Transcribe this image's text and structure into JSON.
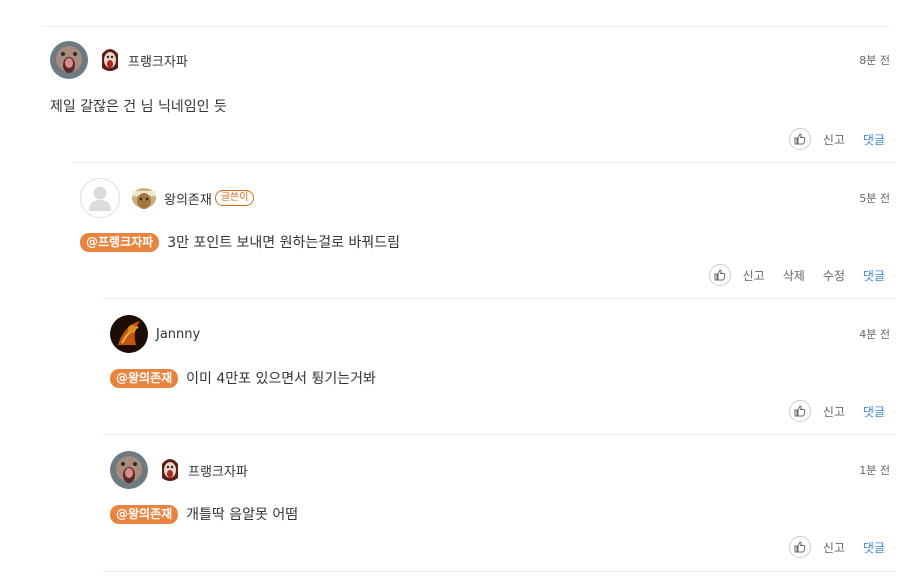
{
  "comments": [
    {
      "nickname": "프랭크자파",
      "time": "8분 전",
      "mention": "",
      "text": "제일 갈잖은 건 님 닉네임인 듯",
      "actions": {
        "report": "신고",
        "reply": "댓글"
      }
    },
    {
      "nickname": "왕의존재",
      "author_badge": "글쓴이",
      "time": "5분 전",
      "mention": "@프랭크자파",
      "text": "3만 포인트 보내면 원하는걸로 바꿔드림",
      "actions": {
        "report": "신고",
        "delete": "삭제",
        "edit": "수정",
        "reply": "댓글"
      }
    },
    {
      "nickname": "Jannny",
      "time": "4분 전",
      "mention": "@왕의존재",
      "text": "이미 4만포 있으면서 튕기는거봐",
      "actions": {
        "report": "신고",
        "reply": "댓글"
      }
    },
    {
      "nickname": "프랭크자파",
      "time": "1분 전",
      "mention": "@왕의존재",
      "text": "개틀딱 음알못 어떰",
      "actions": {
        "report": "신고",
        "reply": "댓글"
      }
    }
  ],
  "icons": {
    "like": "thumbs-up-icon",
    "emblem": "face-emblem-icon"
  },
  "colors": {
    "mention_bg": "#e8843f",
    "reply_link": "#3b8bd9",
    "author_badge": "#e06a1b"
  }
}
